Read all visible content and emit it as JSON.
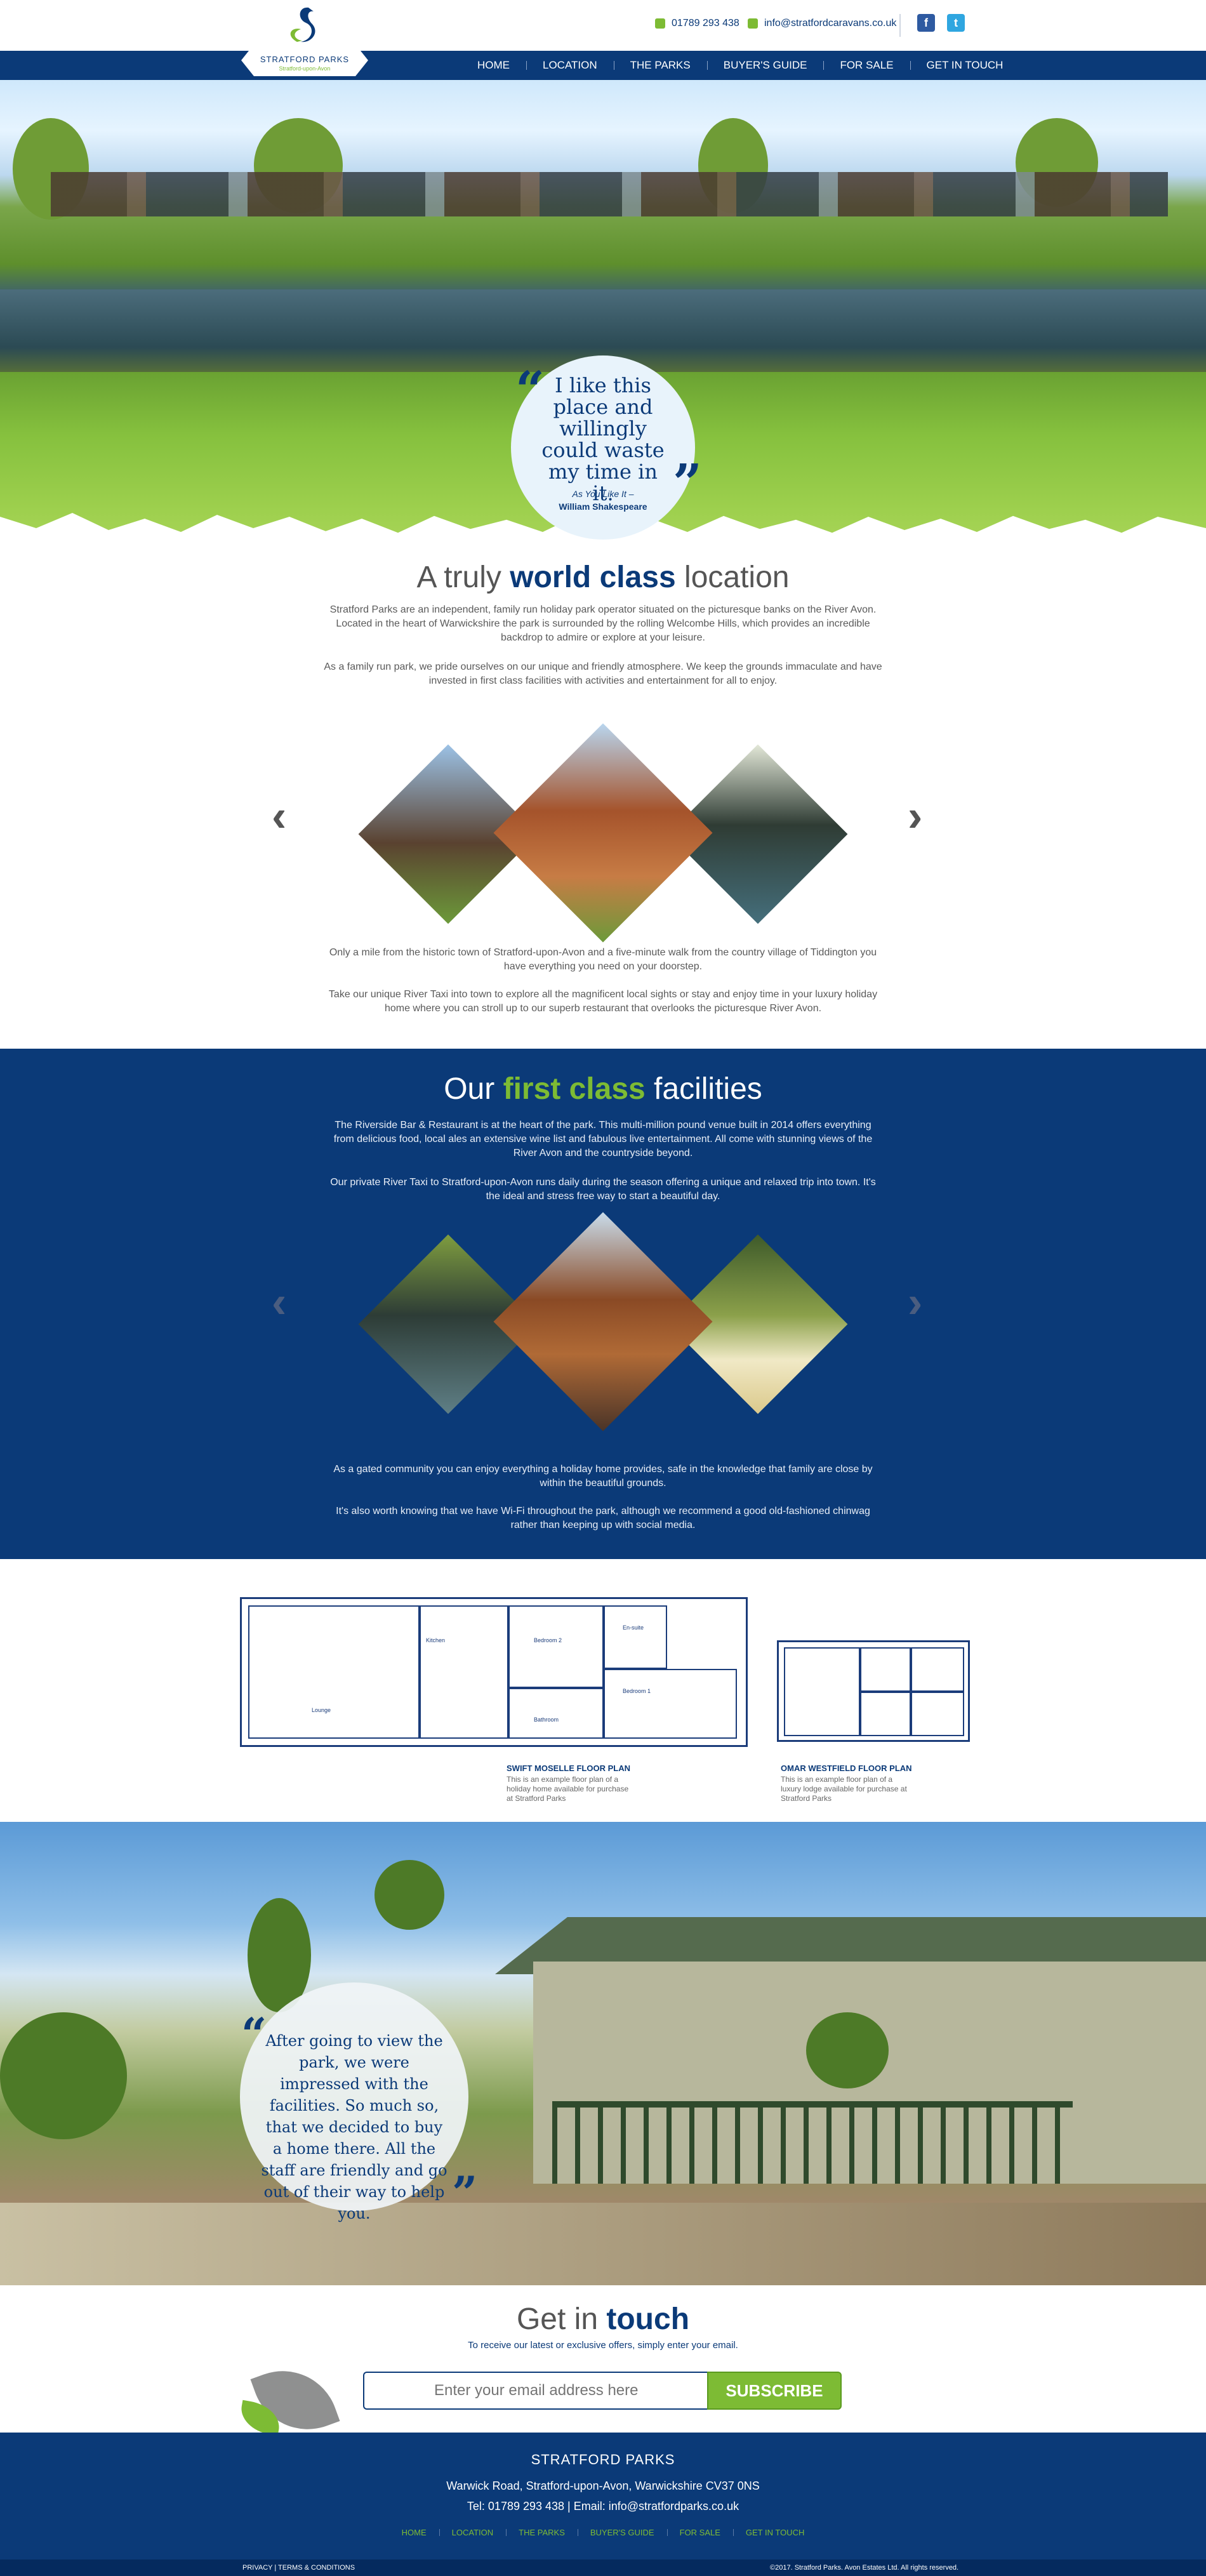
{
  "header": {
    "phone": "01789 293 438",
    "email": "info@stratfordcaravans.co.uk",
    "logo_name": "STRATFORD PARKS",
    "logo_tag": "Stratford-upon-Avon",
    "nav": [
      "HOME",
      "LOCATION",
      "THE PARKS",
      "BUYER'S GUIDE",
      "FOR SALE",
      "GET IN TOUCH"
    ],
    "social": {
      "facebook": "f",
      "twitter": "t"
    }
  },
  "hero_quote": {
    "text": "I like this place and willingly could waste my time in it.",
    "source": "As You Like It –",
    "author": "William Shakespeare"
  },
  "location": {
    "heading_pre": "A truly ",
    "heading_bold": "world class",
    "heading_post": " location",
    "p1": "Stratford Parks are an independent, family run holiday park operator situated on the picturesque banks on the River Avon. Located in the heart of Warwickshire the park is surrounded by the rolling Welcombe Hills, which provides an incredible backdrop to admire or explore at your leisure.",
    "p2": "As a family run park, we pride ourselves on our unique and friendly atmosphere. We keep the grounds immaculate and have invested in first class facilities with activities and entertainment for all to enjoy.",
    "p3": "Only a mile from the historic town of Stratford-upon-Avon and a five-minute walk from the country village of Tiddington you have everything you need on your doorstep.",
    "p4": "Take our unique River Taxi into town to explore all the magnificent local sights or stay and enjoy time in your luxury holiday home where you can stroll up to our superb restaurant that overlooks the picturesque River Avon."
  },
  "facilities": {
    "heading_pre": "Our ",
    "heading_bold": "first class",
    "heading_post": " facilities",
    "p1": "The Riverside Bar & Restaurant is at the heart of the park. This multi-million pound venue built in 2014 offers everything from delicious food, local ales an extensive wine list and fabulous live entertainment. All come with stunning views of the River Avon and the countryside beyond.",
    "p2": "Our private River Taxi to Stratford-upon-Avon runs daily during the season offering a unique and relaxed trip into town. It's the ideal and stress free way to start a beautiful day.",
    "p3": "As a gated community you can enjoy everything a holiday home provides, safe in the knowledge that family are close by within the beautiful grounds.",
    "p4": "It's also worth knowing that we have Wi-Fi throughout the park, although we recommend a good old-fashioned chinwag rather than keeping up with social media."
  },
  "floorplans": [
    {
      "title": "SWIFT MOSELLE FLOOR PLAN",
      "desc": "This is an example floor plan of a holiday home available for purchase at Stratford Parks"
    },
    {
      "title": "OMAR WESTFIELD FLOOR PLAN",
      "desc": "This is an example floor plan of a luxury lodge available for purchase at Stratford Parks"
    }
  ],
  "plan_labels": {
    "kitchen": "Kitchen",
    "lounge": "Lounge",
    "bedroom2": "Bedroom 2",
    "bedroom1": "Bedroom 1",
    "bathroom": "Bathroom",
    "ensuite": "En-suite"
  },
  "testimonial": {
    "text": "After going to view the park, we were impressed with the facilities. So much so, that we decided to buy a home there. All the staff are friendly and go out of their way to help you."
  },
  "touch": {
    "heading_pre": "Get in ",
    "heading_bold": "touch",
    "sub": "To receive our latest or exclusive offers, simply enter your email.",
    "placeholder": "Enter your email address here",
    "button": "SUBSCRIBE"
  },
  "footer": {
    "name": "STRATFORD PARKS",
    "address": "Warwick Road, Stratford-upon-Avon, Warwickshire CV37 0NS",
    "contact": "Tel: 01789 293 438 | Email: info@stratfordparks.co.uk",
    "nav": [
      "HOME",
      "LOCATION",
      "THE PARKS",
      "BUYER'S GUIDE",
      "FOR SALE",
      "GET IN TOUCH"
    ],
    "legal_left": "PRIVACY  |  TERMS & CONDITIONS",
    "legal_right": "©2017. Stratford Parks. Avon Estates Ltd. All rights reserved."
  },
  "colors": {
    "navy": "#0b3a78",
    "green": "#7dbb34"
  },
  "icons": [
    "phone-icon",
    "email-icon",
    "facebook-icon",
    "twitter-icon",
    "chevron-left-icon",
    "chevron-right-icon",
    "quote-open-icon",
    "quote-close-icon",
    "leaf-icon"
  ]
}
